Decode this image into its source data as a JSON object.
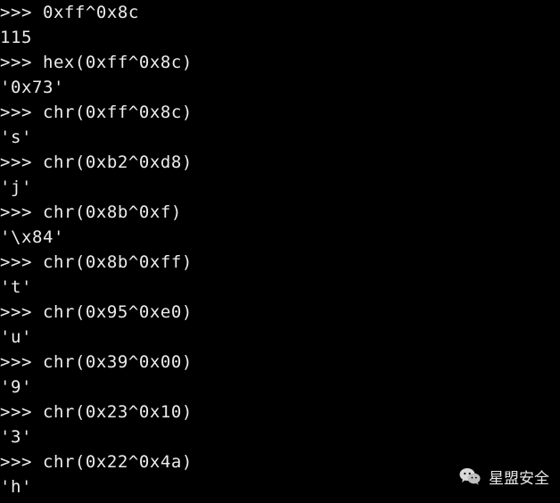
{
  "terminal": {
    "prompt": ">>>",
    "lines": [
      {
        "kind": "input",
        "text": " 0xff^0x8c"
      },
      {
        "kind": "output",
        "text": "115"
      },
      {
        "kind": "input",
        "text": " hex(0xff^0x8c)"
      },
      {
        "kind": "output",
        "text": "'0x73'"
      },
      {
        "kind": "input",
        "text": " chr(0xff^0x8c)"
      },
      {
        "kind": "output",
        "text": "'s'"
      },
      {
        "kind": "input",
        "text": " chr(0xb2^0xd8)"
      },
      {
        "kind": "output",
        "text": "'j'"
      },
      {
        "kind": "input",
        "text": " chr(0x8b^0xf)"
      },
      {
        "kind": "output",
        "text": "'\\x84'"
      },
      {
        "kind": "input",
        "text": " chr(0x8b^0xff)"
      },
      {
        "kind": "output",
        "text": "'t'"
      },
      {
        "kind": "input",
        "text": " chr(0x95^0xe0)"
      },
      {
        "kind": "output",
        "text": "'u'"
      },
      {
        "kind": "input",
        "text": " chr(0x39^0x00)"
      },
      {
        "kind": "output",
        "text": "'9'"
      },
      {
        "kind": "input",
        "text": " chr(0x23^0x10)"
      },
      {
        "kind": "output",
        "text": "'3'"
      },
      {
        "kind": "input",
        "text": " chr(0x22^0x4a)"
      },
      {
        "kind": "output",
        "text": "'h'"
      }
    ]
  },
  "watermark": {
    "text": "星盟安全",
    "icon": "wechat-icon"
  },
  "colors": {
    "background": "#000000",
    "text": "#ececec"
  }
}
